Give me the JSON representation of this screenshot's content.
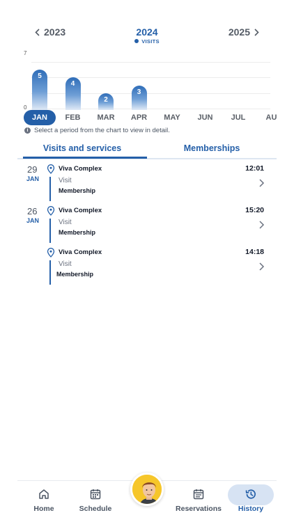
{
  "year_nav": {
    "prev": "2023",
    "current": "2024",
    "next": "2025",
    "legend": "VISITS"
  },
  "chart_data": {
    "type": "bar",
    "categories": [
      "JAN",
      "FEB",
      "MAR",
      "APR",
      "MAY",
      "JUN",
      "JUL",
      "AU"
    ],
    "values": [
      5,
      4,
      2,
      3,
      0,
      0,
      0,
      0
    ],
    "y_ticks": [
      "7",
      "0"
    ],
    "ylim": [
      0,
      7
    ],
    "selected": "JAN",
    "colors": {
      "bar": "#2f6db8",
      "selected": "#245fa8"
    }
  },
  "info_note": "Select a period from the chart to view in detail.",
  "tabs": {
    "visits": "Visits and services",
    "memberships": "Memberships"
  },
  "entries": [
    {
      "day": "29",
      "month": "JAN",
      "venue": "Viva Complex",
      "type": "Visit",
      "membership": "Membership",
      "time": "12:01"
    },
    {
      "day": "26",
      "month": "JAN",
      "venue": "Viva Complex",
      "type": "Visit",
      "membership": "Membership",
      "time": "15:20"
    },
    {
      "day": "",
      "month": "",
      "venue": "Viva Complex",
      "type": "Visit",
      "membership": "Membership",
      "time": "14:18"
    }
  ],
  "nav": {
    "home": "Home",
    "schedule": "Schedule",
    "reservations": "Reservations",
    "history": "History"
  },
  "icons": [
    "chevron-left-icon",
    "chevron-right-icon",
    "info-icon",
    "location-pin-icon",
    "home-icon",
    "calendar-icon",
    "history-icon"
  ]
}
